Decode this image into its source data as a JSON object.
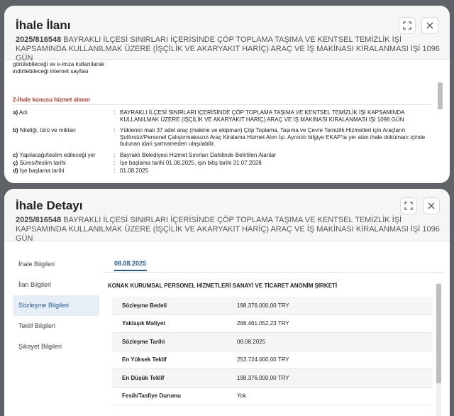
{
  "panel1": {
    "title": "İhale İlanı",
    "subtitle_ikn": "2025/816548",
    "subtitle_text": " BAYRAKLI İLÇESİ SINIRLARI İÇERİSİNDE ÇÖP TOPLAMA TAŞIMA VE KENTSEL TEMİZLİK İŞİ KAPSAMINDA KULLANILMAK ÜZERE (İŞÇİLİK VE AKARYAKIT HARİÇ) ARAÇ VE İŞ MAKİNASI KİRALANMASI İŞİ 1096 GÜN",
    "expand_icon": "expand-icon",
    "close_icon": "close-icon",
    "fragment": "görülebileceği ve e-imza kullanılarak indirilebileceği internet sayfası",
    "section_heading": "2-İhale konusu hizmet alımın",
    "rows": [
      {
        "key": "a)",
        "label": " Adı",
        "value": "BAYRAKLI İLÇESİ SINIRLARI İÇERİSİNDE ÇÖP TOPLAMA TAŞIMA VE KENTSEL TEMİZLİK İŞİ KAPSAMINDA KULLANILMAK ÜZERE (İŞÇİLİK VE AKARYAKIT HARİÇ) ARAÇ VE İŞ MAKİNASI KİRALANMASI İŞİ 1096 GÜN"
      },
      {
        "key": "b)",
        "label": " Niteliği, türü ve miktarı",
        "value": "Yüklenici malı 37 adet araç (makine ve ekipman) Çöp Toplama, Taşıma ve Çevre Temizlik Hizmetleri için Araçların Şoförsüz/Personel Çalıştırmaksızın Araç Kiralama Hizmet Alım İşi. Ayrıntılı bilgiye EKAP’ta yer alan ihale dokümanı içinde bulunan idari şartnameden ulaşılabilir."
      },
      {
        "key": "c)",
        "label": " Yapılacağı/teslim edileceği yer",
        "value": "Bayraklı Belediyesi Hizmet Sınırları Dahilinde Belirtilen Alanlar"
      },
      {
        "key": "ç)",
        "label": " Süresi/teslim tarihi",
        "value": "İşe başlama tarihi 01.08.2025, işin bitiş tarihi 31.07.2028"
      },
      {
        "key": "d)",
        "label": " İşe başlama tarihi",
        "value": "01.08.2025"
      }
    ]
  },
  "panel2": {
    "title": "İhale Detayı",
    "subtitle_ikn": "2025/816548",
    "subtitle_text": " BAYRAKLI İLÇESİ SINIRLARI İÇERİSİNDE ÇÖP TOPLAMA TAŞIMA VE KENTSEL TEMİZLİK İŞİ KAPSAMINDA KULLANILMAK ÜZERE (İŞÇİLİK VE AKARYAKIT HARİÇ) ARAÇ VE İŞ MAKİNASI KİRALANMASI İŞİ 1096 GÜN",
    "expand_icon": "expand-icon",
    "close_icon": "close-icon",
    "sidebar": [
      {
        "label": "İhale Bilgileri",
        "active": false
      },
      {
        "label": "İlan Bilgileri",
        "active": false
      },
      {
        "label": "Sözleşme Bilgileri",
        "active": true
      },
      {
        "label": "Teklif Bilgileri",
        "active": false
      },
      {
        "label": "Şikayet Bilgileri",
        "active": false
      }
    ],
    "tab_date": "08.08.2025",
    "company": "KONAK KURUMSAL PERSONEL HİZMETLERİ SANAYİ VE TİCARET ANONİM ŞİRKETİ",
    "table": [
      {
        "key": "Sözleşme Bedeli",
        "value": "198.376.000,00 TRY"
      },
      {
        "key": "Yaklaşık Maliyet",
        "value": "268.461.052,23 TRY"
      },
      {
        "key": "Sözleşme Tarihi",
        "value": "08.08.2025"
      },
      {
        "key": "En Yüksek Teklif",
        "value": "253.724.000,00 TRY"
      },
      {
        "key": "En Düşük Teklif",
        "value": "198.376.000,00 TRY"
      },
      {
        "key": "Fesih/Tasfiye Durumu",
        "value": "Yok"
      }
    ]
  }
}
